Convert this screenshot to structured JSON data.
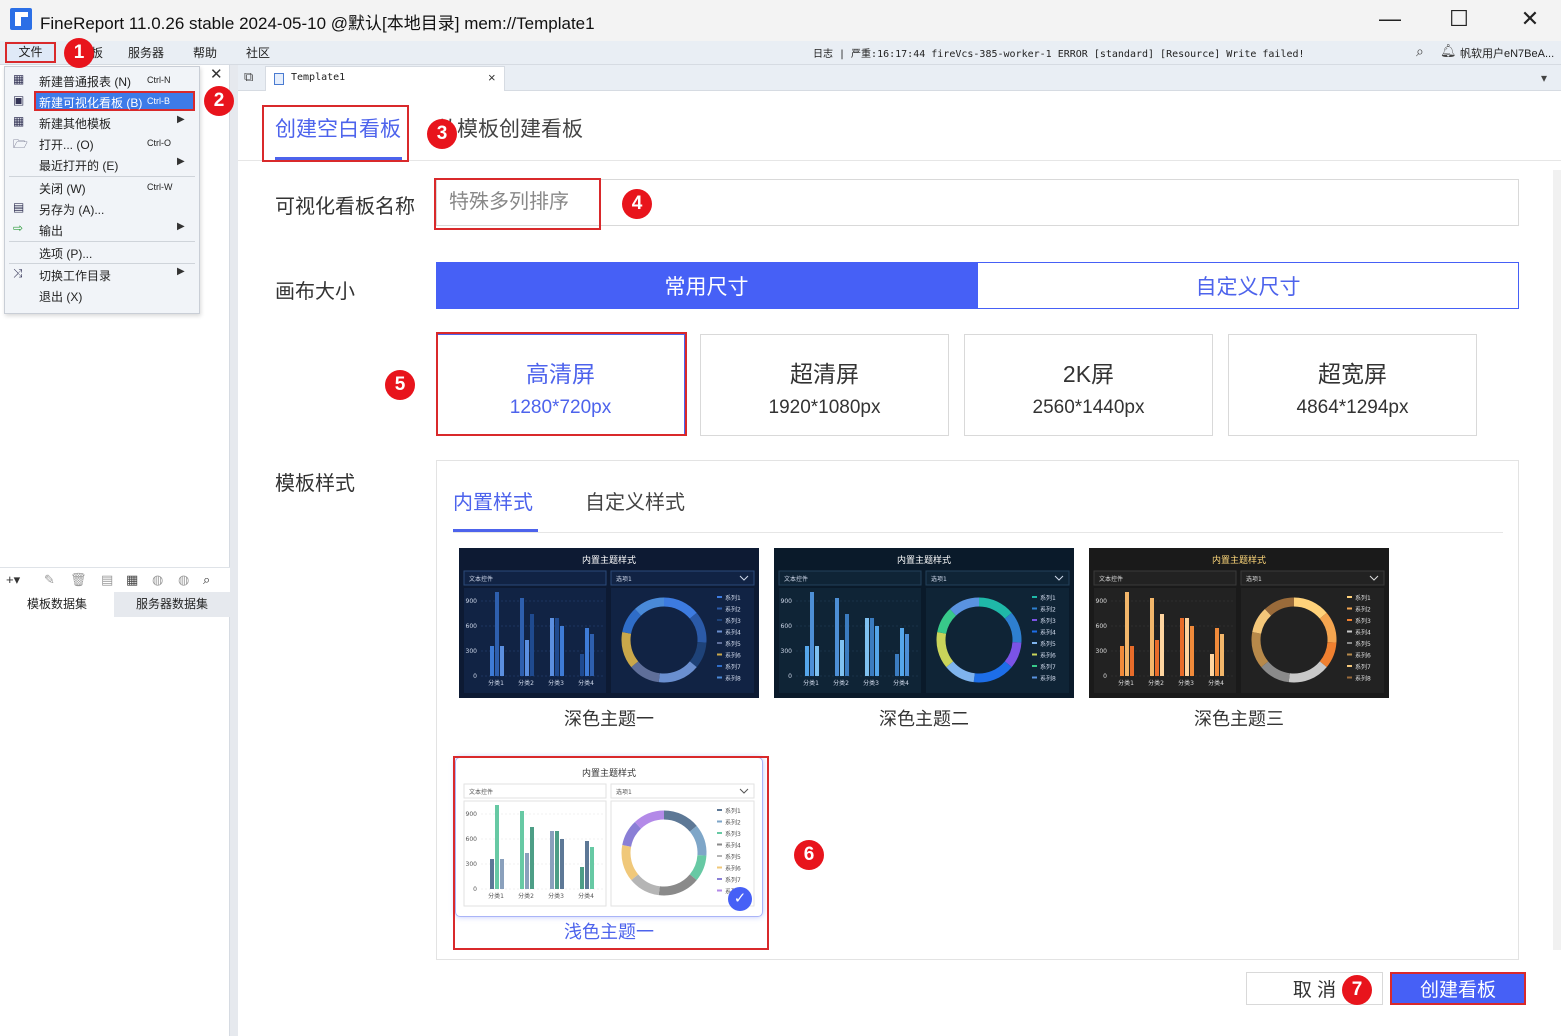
{
  "window": {
    "title": "FineReport 11.0.26 stable 2024-05-10 @默认[本地目录]      mem://Template1",
    "minimize": "—",
    "maximize": "☐",
    "close": "✕"
  },
  "menubar": {
    "items": [
      "文件",
      "板",
      "服务器",
      "帮助",
      "社区"
    ],
    "log": "日志 | 严重:16:17:44 fireVcs-385-worker-1 ERROR [standard] [Resource] Write failed!",
    "user": "帆软用户eN7BeA..."
  },
  "file_menu": {
    "items": [
      {
        "label": "新建普通报表 (N)",
        "shortcut": "Ctrl-N",
        "icon": "grid-icon"
      },
      {
        "label": "新建可视化看板 (B)",
        "shortcut": "Ctrl-B",
        "icon": "dashboard-icon"
      },
      {
        "label": "新建其他模板",
        "shortcut": "",
        "icon": "template-icon"
      },
      {
        "label": "打开... (O)",
        "shortcut": "Ctrl-O",
        "icon": "folder-icon"
      },
      {
        "label": "最近打开的 (E)",
        "shortcut": "",
        "icon": ""
      },
      {
        "label": "关闭 (W)",
        "shortcut": "Ctrl-W",
        "icon": ""
      },
      {
        "label": "另存为 (A)...",
        "shortcut": "",
        "icon": "save-as-icon"
      },
      {
        "label": "输出",
        "shortcut": "",
        "icon": "export-icon"
      },
      {
        "label": "选项 (P)...",
        "shortcut": "",
        "icon": ""
      },
      {
        "label": "切换工作目录",
        "shortcut": "",
        "icon": "shuffle-icon"
      },
      {
        "label": "退出 (X)",
        "shortcut": "",
        "icon": ""
      }
    ],
    "arrow": "▶"
  },
  "left_panel": {
    "tabs": [
      "模板数据集",
      "服务器数据集"
    ]
  },
  "doc_tab": {
    "label": "Template1",
    "close": "×"
  },
  "dialog": {
    "tabs": [
      "创建空白看板",
      "从模板创建看板"
    ],
    "name_label": "可视化看板名称",
    "name_placeholder": "特殊多列排序",
    "canvas_label": "画布大小",
    "canvas_modes": [
      "常用尺寸",
      "自定义尺寸"
    ],
    "sizes": [
      {
        "name": "高清屏",
        "px": "1280*720px"
      },
      {
        "name": "超清屏",
        "px": "1920*1080px"
      },
      {
        "name": "2K屏",
        "px": "2560*1440px"
      },
      {
        "name": "超宽屏",
        "px": "4864*1294px"
      }
    ],
    "style_label": "模板样式",
    "style_tabs": [
      "内置样式",
      "自定义样式"
    ],
    "themes": [
      {
        "label": "深色主题一"
      },
      {
        "label": "深色主题二"
      },
      {
        "label": "深色主题三"
      },
      {
        "label": "浅色主题一"
      }
    ],
    "thumb": {
      "title": "内置主题样式",
      "text_control": "文本控件",
      "dropdown": "选项1",
      "y_ticks": [
        "900",
        "600",
        "300",
        "0"
      ],
      "categories": [
        "分类1",
        "分类2",
        "分类3",
        "分类4"
      ],
      "legend": [
        "系列1",
        "系列2",
        "系列3",
        "系列4",
        "系列5",
        "系列6",
        "系列7",
        "系列8"
      ]
    },
    "cancel": "取 消",
    "create": "创建看板",
    "check": "✓"
  },
  "annotations": [
    "1",
    "2",
    "3",
    "4",
    "5",
    "6",
    "7"
  ]
}
